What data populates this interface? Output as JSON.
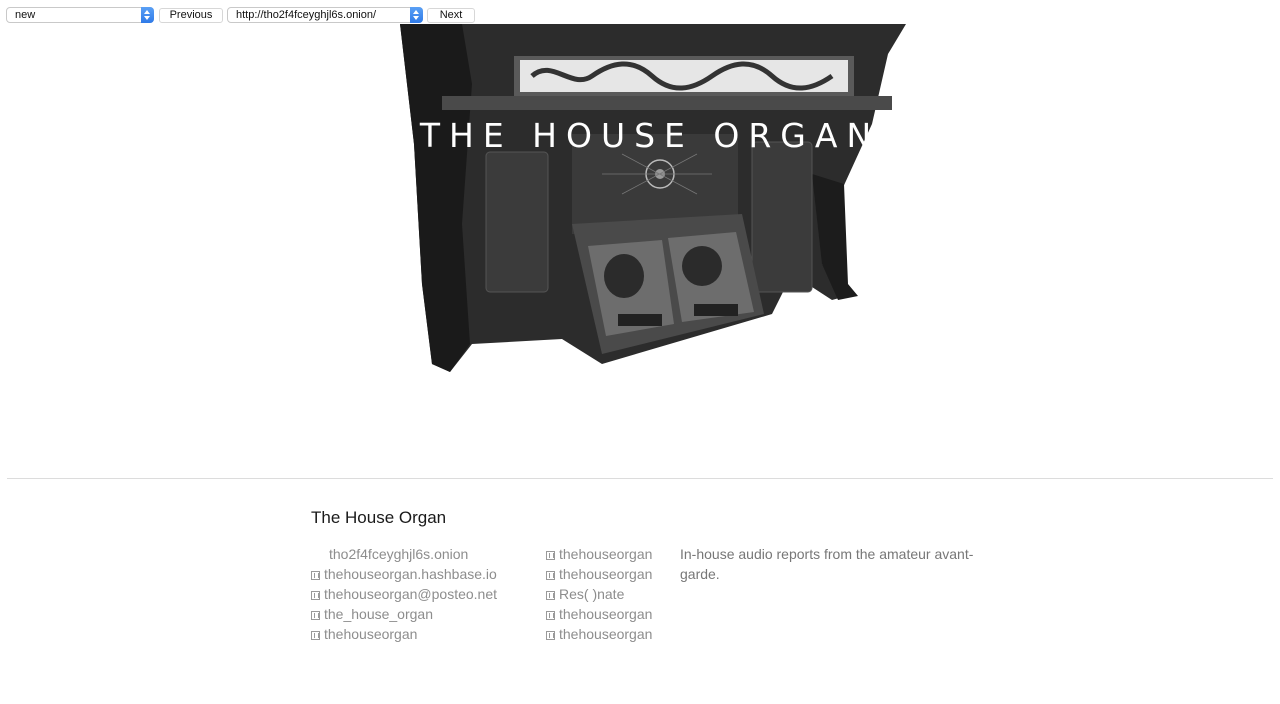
{
  "nav": {
    "mode_select": "new",
    "previous_label": "Previous",
    "url_select": "http://tho2f4fceyghjl6s.onion/",
    "next_label": "Next"
  },
  "hero": {
    "title": "THE HOUSE ORGAN"
  },
  "footer": {
    "site_title": "The House Organ",
    "links_left": [
      {
        "text": "tho2f4fceyghjl6s.onion",
        "icon": "none"
      },
      {
        "text": "thehouseorgan.hashbase.io",
        "icon": "link-icon"
      },
      {
        "text": "thehouseorgan@posteo.net",
        "icon": "link-icon"
      },
      {
        "text": "the_house_organ",
        "icon": "link-icon"
      },
      {
        "text": "thehouseorgan",
        "icon": "link-icon"
      }
    ],
    "links_right": [
      {
        "text": "thehouseorgan",
        "icon": "link-icon"
      },
      {
        "text": "thehouseorgan",
        "icon": "link-icon"
      },
      {
        "text": "Res( )nate",
        "icon": "link-icon"
      },
      {
        "text": "thehouseorgan",
        "icon": "link-icon"
      },
      {
        "text": "thehouseorgan",
        "icon": "link-icon"
      }
    ],
    "description": "In-house audio reports from the amateur avant-garde."
  }
}
